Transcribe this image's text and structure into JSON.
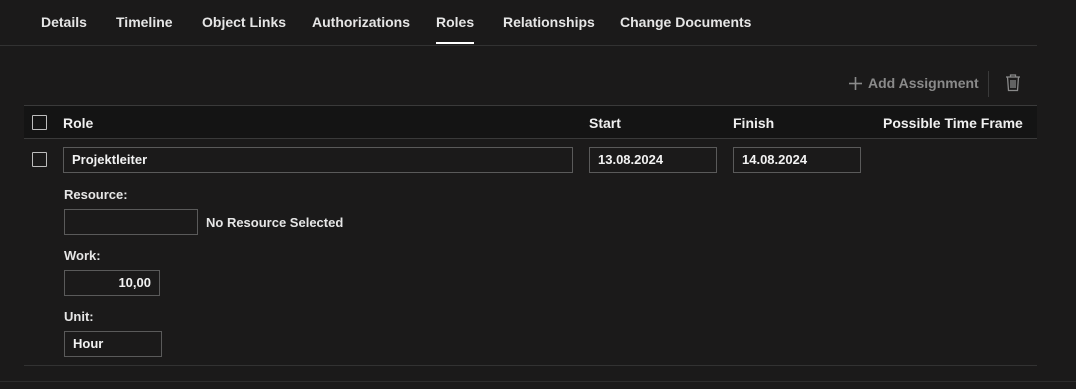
{
  "tabs": [
    {
      "label": "Details",
      "active": false
    },
    {
      "label": "Timeline",
      "active": false
    },
    {
      "label": "Object Links",
      "active": false
    },
    {
      "label": "Authorizations",
      "active": false
    },
    {
      "label": "Roles",
      "active": true
    },
    {
      "label": "Relationships",
      "active": false
    },
    {
      "label": "Change Documents",
      "active": false
    }
  ],
  "toolbar": {
    "add_label": "Add Assignment",
    "add_icon": "plus-icon",
    "delete_icon": "trash-icon",
    "add_color": "#8a8a8a"
  },
  "table": {
    "columns": [
      "Role",
      "Start",
      "Finish",
      "Possible Time Frame"
    ],
    "rows": [
      {
        "role": "Projektleiter",
        "start": "13.08.2024",
        "finish": "14.08.2024",
        "resource_label": "Resource:",
        "resource_value": "",
        "resource_status": "No Resource Selected",
        "work_label": "Work:",
        "work_value": "10,00",
        "unit_label": "Unit:",
        "unit_value": "Hour"
      }
    ]
  },
  "colors": {
    "background": "#1b1a1a",
    "header_background": "#141414",
    "active_tab_underline": "#ffffff"
  }
}
